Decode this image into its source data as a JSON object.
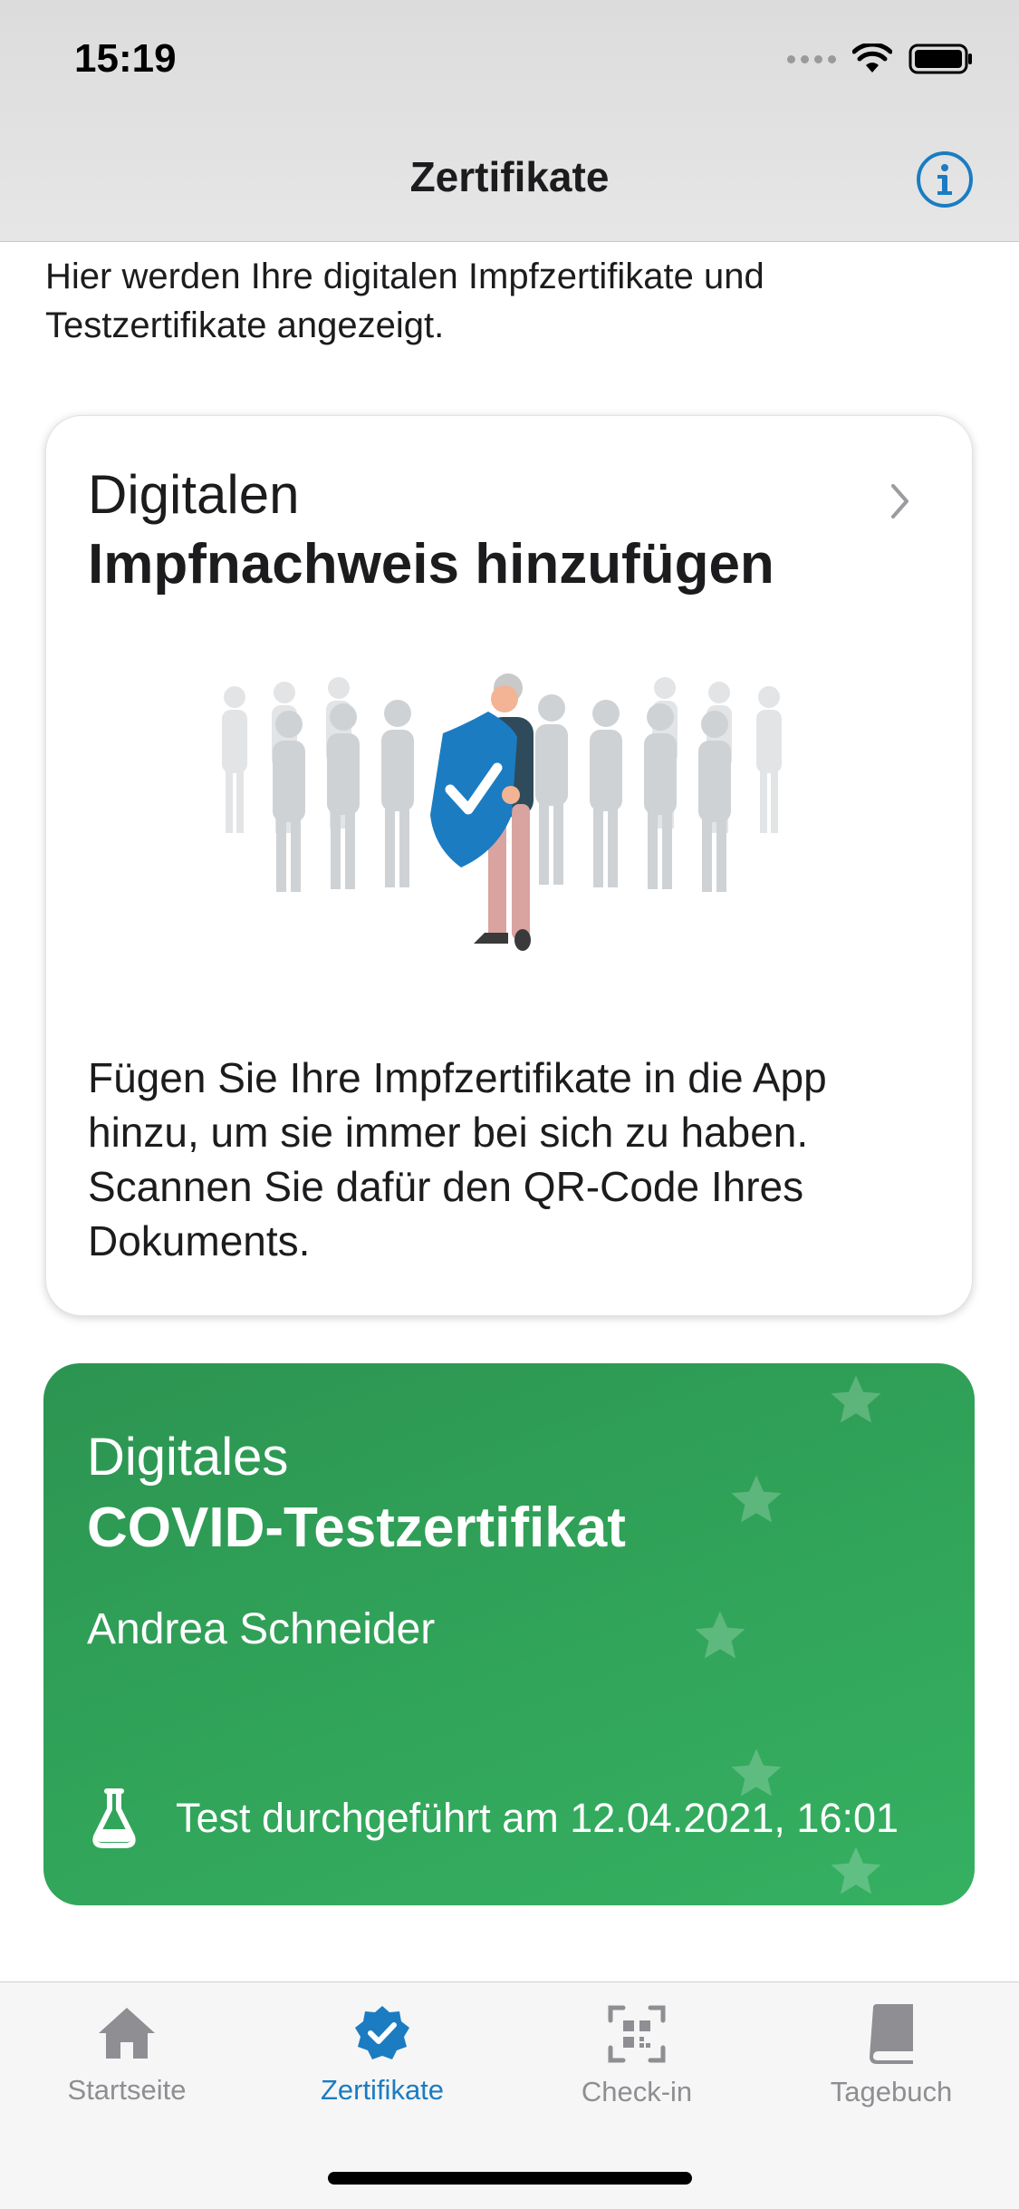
{
  "status_bar": {
    "time": "15:19"
  },
  "nav": {
    "title": "Zertifikate",
    "info_icon": "info-circle-icon"
  },
  "intro_text": "Hier werden Ihre digitalen Impfzertifikate und Testzertifikate angezeigt.",
  "vaccination_card": {
    "subtitle": "Digitalen",
    "title": "Impfnachweis hinzufügen",
    "description": "Fügen Sie Ihre Impfzertifikate in die App hinzu, um sie immer bei sich zu haben. Scannen Sie dafür den QR-Code Ihres Dokuments."
  },
  "test_certificate": {
    "subtitle": "Digitales",
    "title": "COVID-Testzertifikat",
    "name": "Andrea Schneider",
    "test_info": "Test durchgeführt am 12.04.2021, 16:01",
    "color": "#31a55a"
  },
  "tabbar": {
    "items": [
      {
        "label": "Startseite",
        "icon": "home-icon"
      },
      {
        "label": "Zertifikate",
        "icon": "certificate-check-icon",
        "active": true
      },
      {
        "label": "Check-in",
        "icon": "qr-scan-icon"
      },
      {
        "label": "Tagebuch",
        "icon": "book-icon"
      }
    ],
    "active_color": "#1b7cc2"
  }
}
